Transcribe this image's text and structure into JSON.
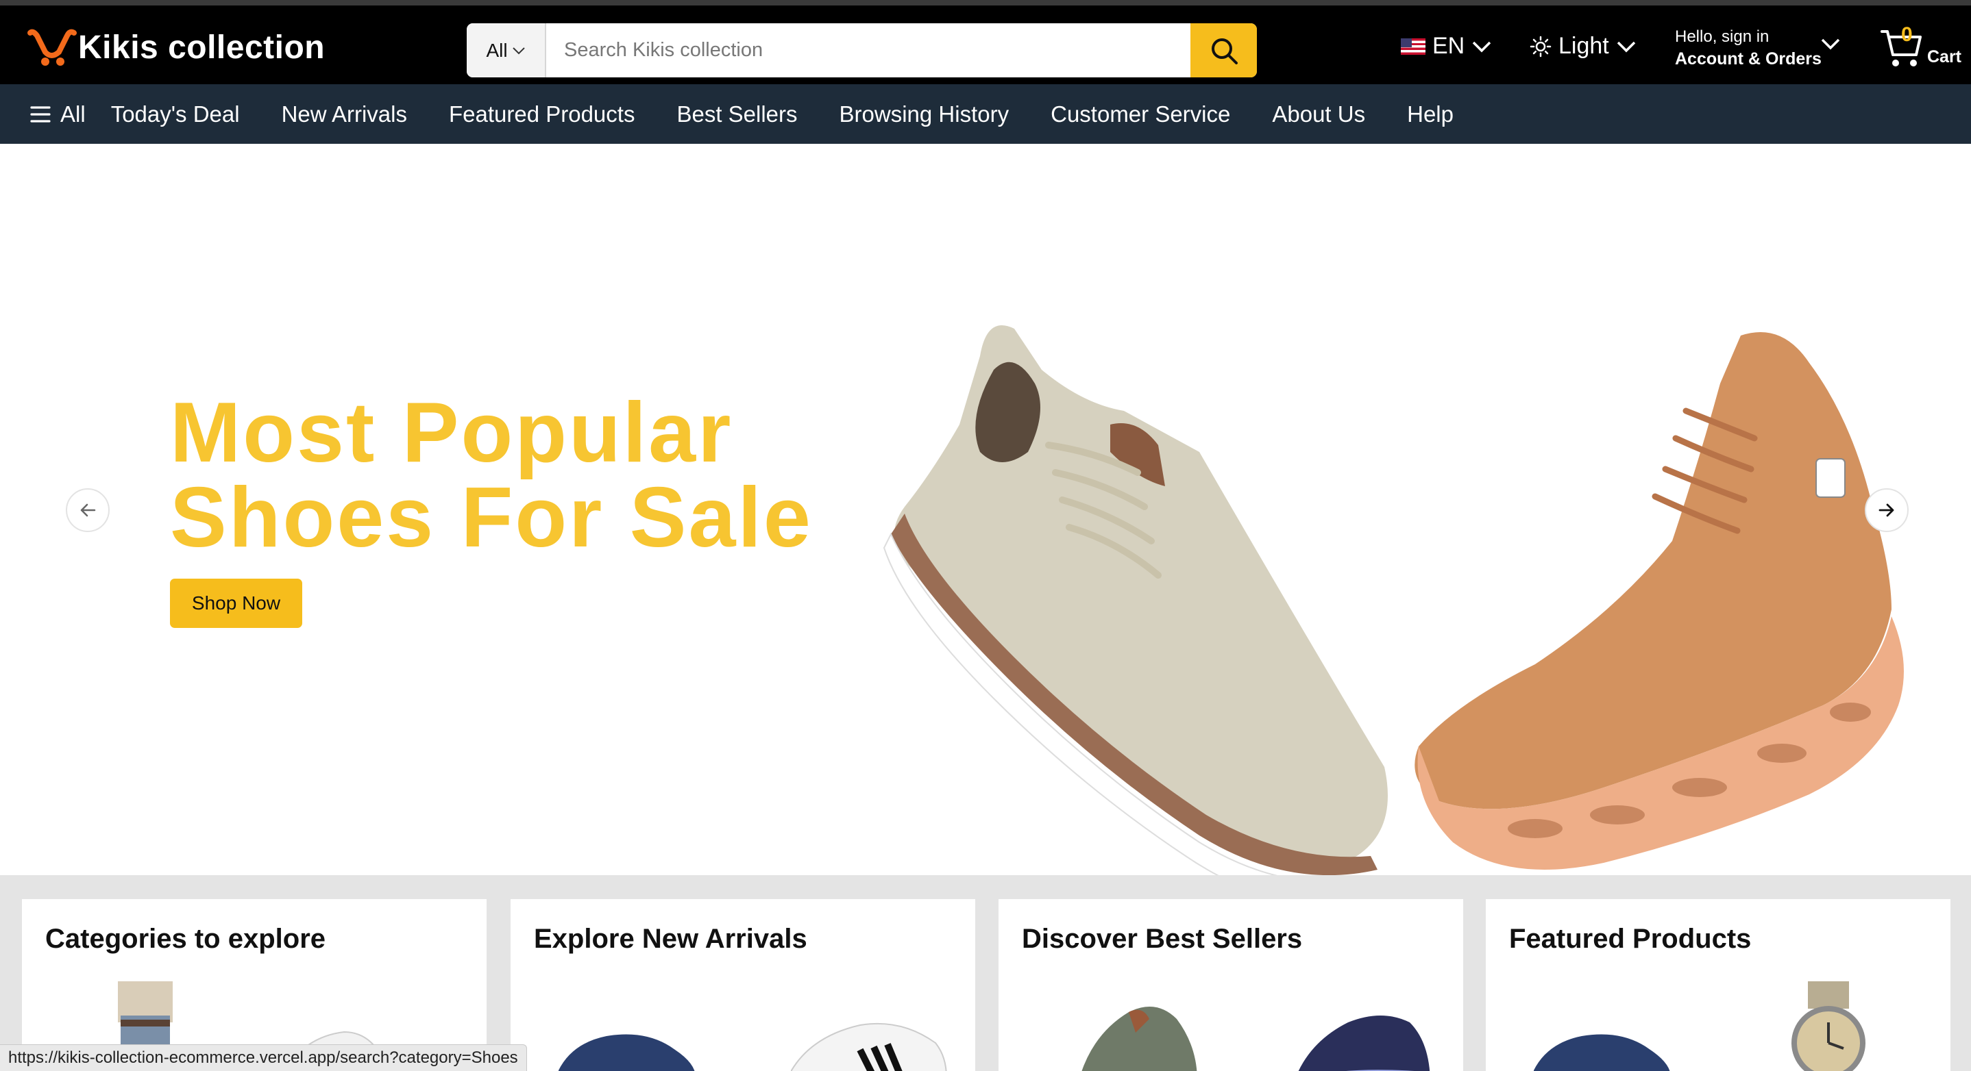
{
  "brand": {
    "name": "Kikis collection"
  },
  "search": {
    "category": "All",
    "placeholder": "Search Kikis collection"
  },
  "header": {
    "language": "EN",
    "theme": "Light",
    "account_greeting": "Hello, sign in",
    "account_label": "Account & Orders",
    "cart_count": "0",
    "cart_label": "Cart"
  },
  "nav": {
    "all_label": "All",
    "links": [
      "Today's Deal",
      "New Arrivals",
      "Featured Products",
      "Best Sellers",
      "Browsing History",
      "Customer Service",
      "About Us",
      "Help"
    ]
  },
  "hero": {
    "title_line1": "Most Popular",
    "title_line2": "Shoes For Sale",
    "cta": "Shop Now"
  },
  "cards": [
    {
      "title": "Categories to explore"
    },
    {
      "title": "Explore New Arrivals"
    },
    {
      "title": "Discover Best Sellers"
    },
    {
      "title": "Featured Products"
    }
  ],
  "status_url": "https://kikis-collection-ecommerce.vercel.app/search?category=Shoes",
  "colors": {
    "accent": "#f6bd1c",
    "hero_title": "#f7c531",
    "header_bg": "#000000",
    "nav_bg": "#1e2c3a",
    "logo": "#f26a1b"
  }
}
